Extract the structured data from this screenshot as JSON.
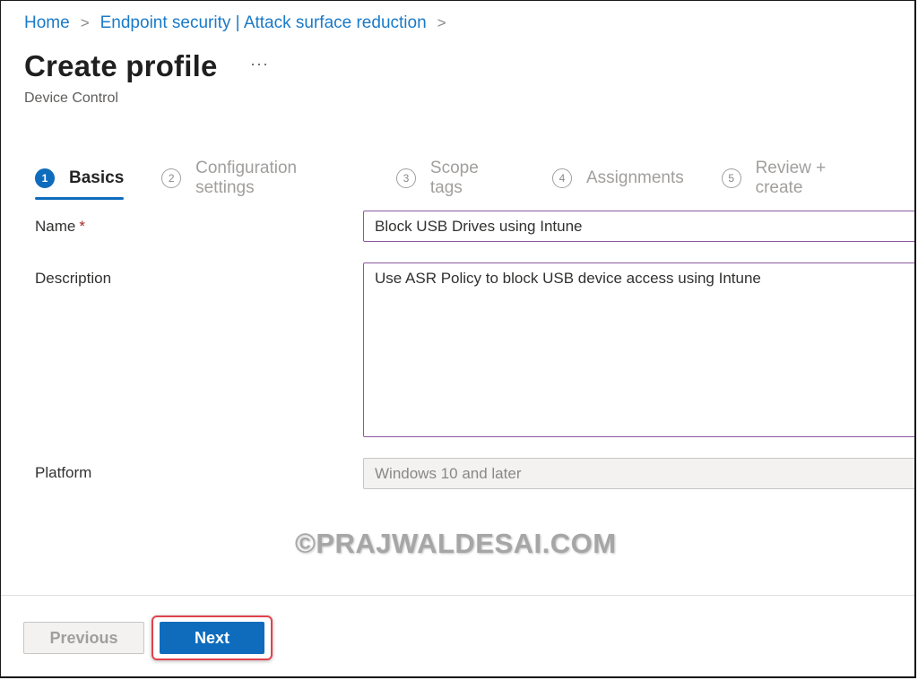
{
  "breadcrumb": {
    "items": [
      "Home",
      "Endpoint security | Attack surface reduction"
    ],
    "separator": ">"
  },
  "header": {
    "title": "Create profile",
    "more_label": "···",
    "subtitle": "Device Control"
  },
  "steps": [
    {
      "number": "1",
      "label": "Basics",
      "active": true
    },
    {
      "number": "2",
      "label": "Configuration settings",
      "active": false
    },
    {
      "number": "3",
      "label": "Scope tags",
      "active": false
    },
    {
      "number": "4",
      "label": "Assignments",
      "active": false
    },
    {
      "number": "5",
      "label": "Review + create",
      "active": false
    }
  ],
  "form": {
    "name": {
      "label": "Name",
      "required_marker": "*",
      "value": "Block USB Drives using Intune"
    },
    "description": {
      "label": "Description",
      "value": "Use ASR Policy to block USB device access using Intune"
    },
    "platform": {
      "label": "Platform",
      "value": "Windows 10 and later"
    }
  },
  "watermark": "©PRAJWALDESAI.COM",
  "footer": {
    "previous_label": "Previous",
    "next_label": "Next"
  },
  "colors": {
    "accent": "#0f6cbd",
    "link": "#1a7ac8",
    "field_border": "#8a5a9e",
    "highlight": "#e0424c",
    "required": "#a4262c"
  }
}
